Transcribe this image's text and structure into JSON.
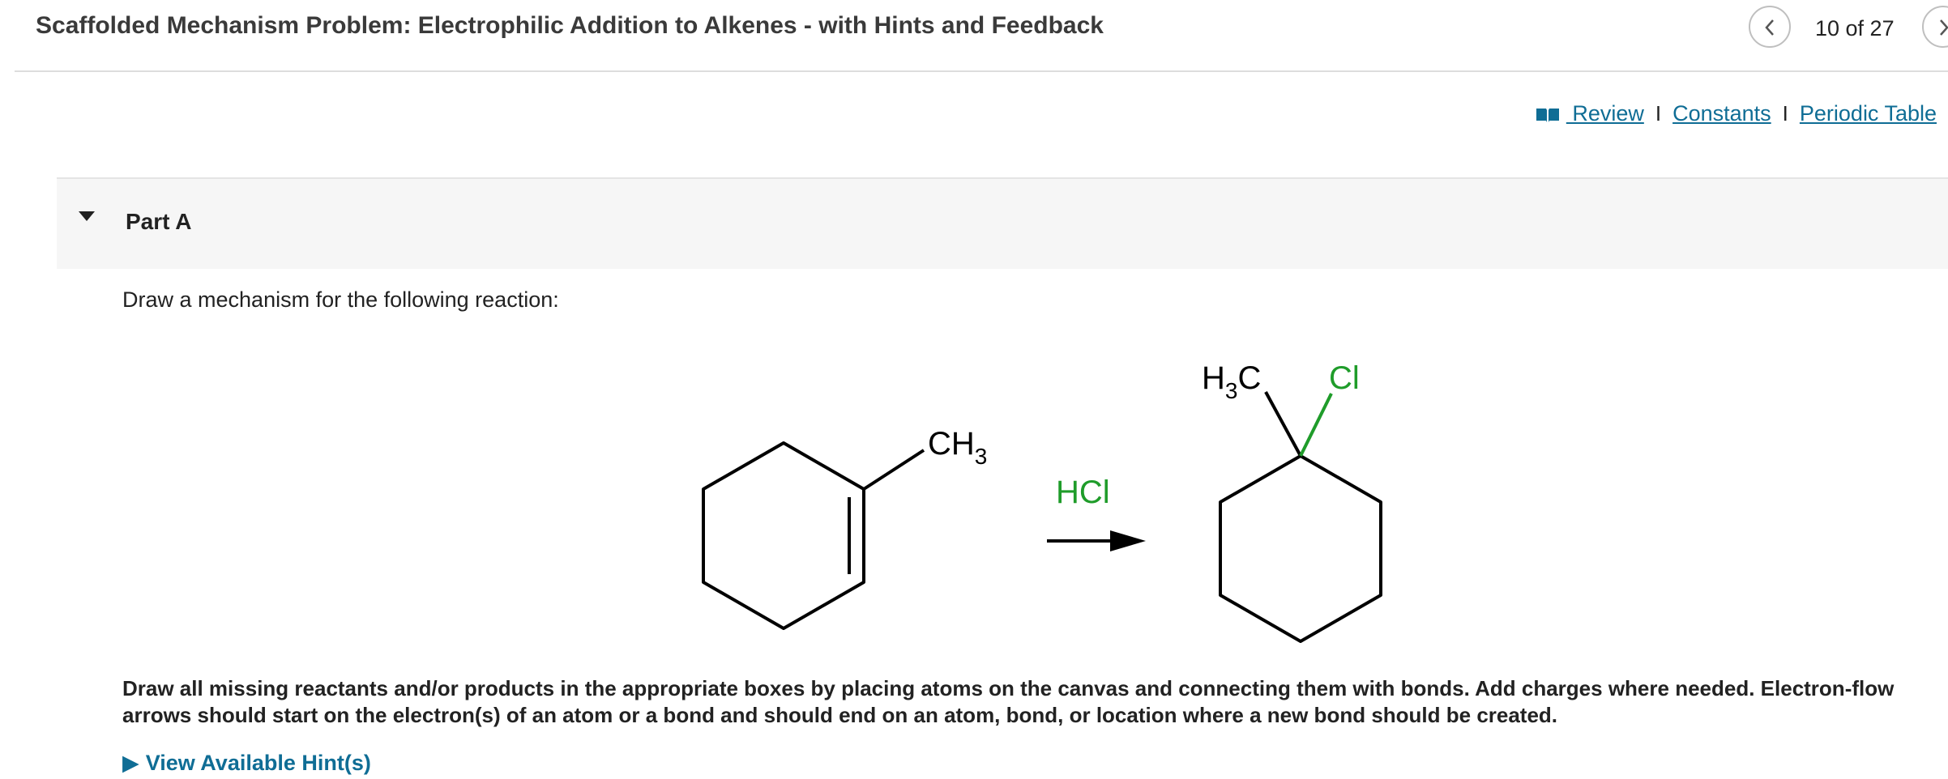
{
  "header": {
    "title": "Scaffolded Mechanism Problem: Electrophilic Addition to Alkenes - with Hints and Feedback",
    "counter": "10 of 27",
    "prev_icon": "chevron-left-icon",
    "next_icon": "chevron-right-icon"
  },
  "links": {
    "review_icon": "book-icon",
    "review": " Review",
    "separator": "I",
    "constants": "Constants",
    "periodic_table": "Periodic Table"
  },
  "part": {
    "label": "Part A",
    "toggle_icon": "caret-down-icon"
  },
  "question": {
    "prompt": "Draw a mechanism for the following reaction:",
    "instructions": "Draw all missing reactants and/or products in the appropriate boxes by placing atoms on the canvas and connecting them with bonds. Add charges where needed. Electron-flow arrows should start on the electron(s) of an atom or a bond and should end on an atom, bond, or location where a new bond should be created.",
    "hint_link": "View Available Hint(s)"
  },
  "reaction": {
    "reactant_label_main": "CH",
    "reactant_label_sub": "3",
    "reagent": "HCl",
    "product_methyl_main": "H",
    "product_methyl_sub": "3",
    "product_methyl_tail": "C",
    "product_halogen": "Cl"
  },
  "colors": {
    "link": "#0f6d95",
    "reagent_green": "#1f9c2a",
    "bond_black": "#000000",
    "part_bg": "#f6f6f6"
  }
}
